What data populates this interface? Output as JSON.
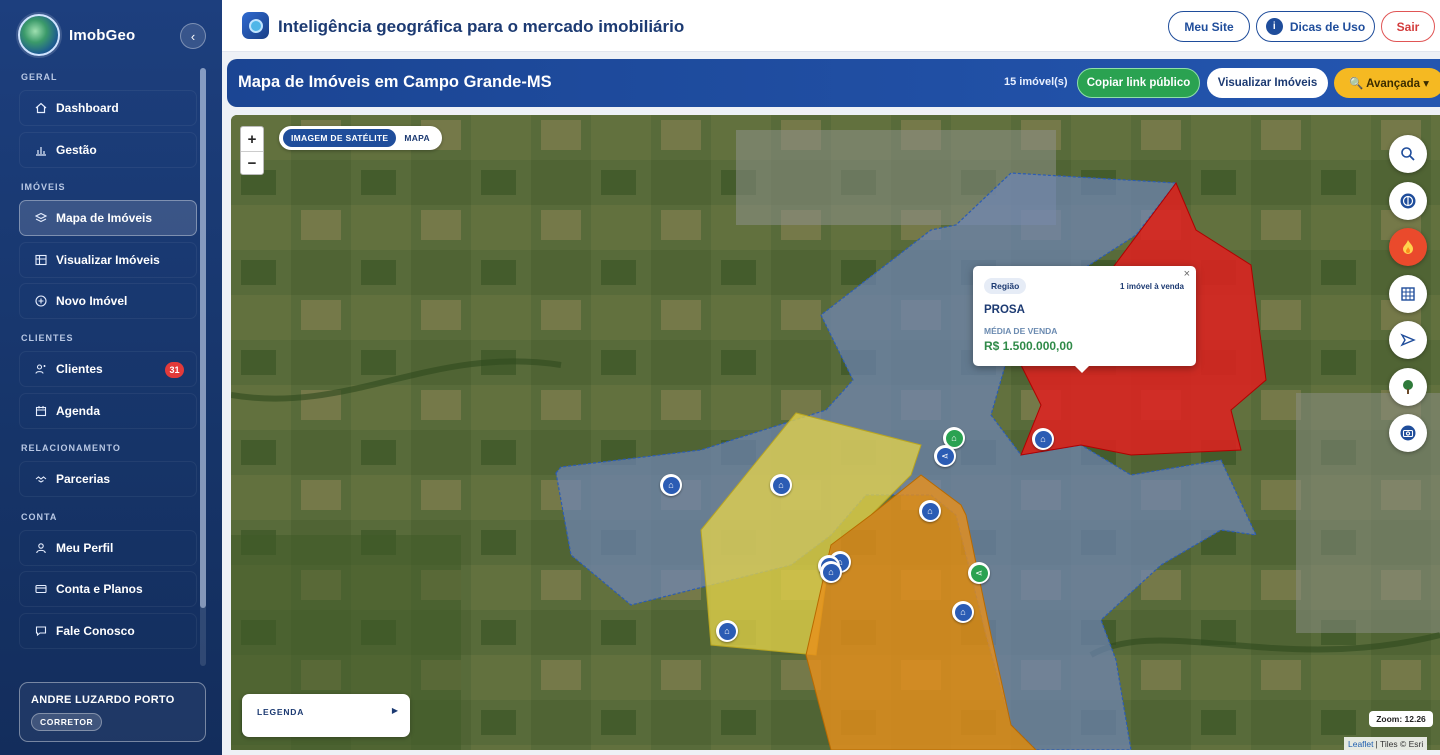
{
  "sidebar": {
    "brand": "ImobGeo",
    "collapse_icon": "‹",
    "sections": {
      "geral": "GERAL",
      "imoveis": "IMÓVEIS",
      "clientes": "CLIENTES",
      "relacionamento": "RELACIONAMENTO",
      "conta": "CONTA"
    },
    "items": {
      "dashboard": "Dashboard",
      "gestao": "Gestão",
      "mapa": "Mapa de Imóveis",
      "visualizar": "Visualizar Imóveis",
      "novo": "Novo Imóvel",
      "clientes": "Clientes",
      "clientes_badge": "31",
      "agenda": "Agenda",
      "parcerias": "Parcerias",
      "perfil": "Meu Perfil",
      "planos": "Conta e Planos",
      "fale": "Fale Conosco"
    },
    "user": {
      "name": "ANDRE LUZARDO PORTO",
      "role": "CORRETOR"
    }
  },
  "header": {
    "title": "Inteligência geográfica para o mercado imobiliário",
    "meu_site": "Meu Site",
    "dicas": "Dicas de Uso",
    "sair": "Sair",
    "info_glyph": "i"
  },
  "page": {
    "title": "Mapa de Imóveis em Campo Grande-MS",
    "count": "15 imóvel(s)",
    "copy_link": "Copiar link público",
    "view_properties": "Visualizar Imóveis",
    "advanced": "🔍 Avançada ▾"
  },
  "map": {
    "layers": {
      "satellite": "IMAGEM DE SATÉLITE",
      "map": "MAPA"
    },
    "zoom_in": "+",
    "zoom_out": "−",
    "popup": {
      "tag": "Região",
      "count": "1 imóvel à venda",
      "close": "×",
      "name": "PROSA",
      "label": "MÉDIA DE VENDA",
      "value": "R$ 1.500.000,00"
    },
    "legend": {
      "label": "LEGENDA",
      "arrow": "▶"
    },
    "zoom_readout": "Zoom: 12.26",
    "attribution": {
      "leaflet": "Leaflet",
      "rest": "| Tiles © Esri"
    },
    "region_colors": {
      "blue": "#6f86b8",
      "red": "#e02020",
      "yellow": "#e8d64a",
      "orange": "#e8901c"
    },
    "tools": [
      "search-icon",
      "compass-icon",
      "fire-icon",
      "grid-icon",
      "route-icon",
      "tree-icon",
      "camera-icon"
    ]
  }
}
